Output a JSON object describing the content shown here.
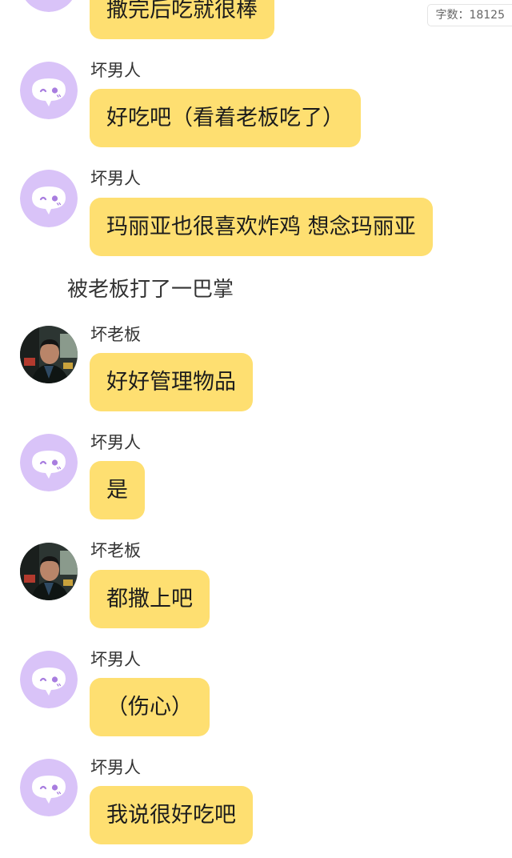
{
  "word_count": "字数：18125",
  "narration": "被老板打了一巴掌",
  "messages": [
    {
      "sender": "",
      "text": "撒完后吃就很棒",
      "avatar": "cartoon-face-icon"
    },
    {
      "sender": "坏男人",
      "text": "好吃吧（看着老板吃了）",
      "avatar": "cartoon-face-icon"
    },
    {
      "sender": "坏男人",
      "text": "玛丽亚也很喜欢炸鸡 想念玛丽亚",
      "avatar": "cartoon-face-icon"
    },
    {
      "sender": "坏老板",
      "text": "好好管理物品",
      "avatar": "boss-photo"
    },
    {
      "sender": "坏男人",
      "text": "是",
      "avatar": "cartoon-face-icon"
    },
    {
      "sender": "坏老板",
      "text": "都撒上吧",
      "avatar": "boss-photo"
    },
    {
      "sender": "坏男人",
      "text": "（伤心）",
      "avatar": "cartoon-face-icon"
    },
    {
      "sender": "坏男人",
      "text": "我说很好吃吧",
      "avatar": "cartoon-face-icon"
    }
  ],
  "colors": {
    "bubble": "#fedf71",
    "avatar_bg": "#d9c3f8",
    "avatar_face": "#ffffff",
    "avatar_eye": "#a87ddf"
  }
}
